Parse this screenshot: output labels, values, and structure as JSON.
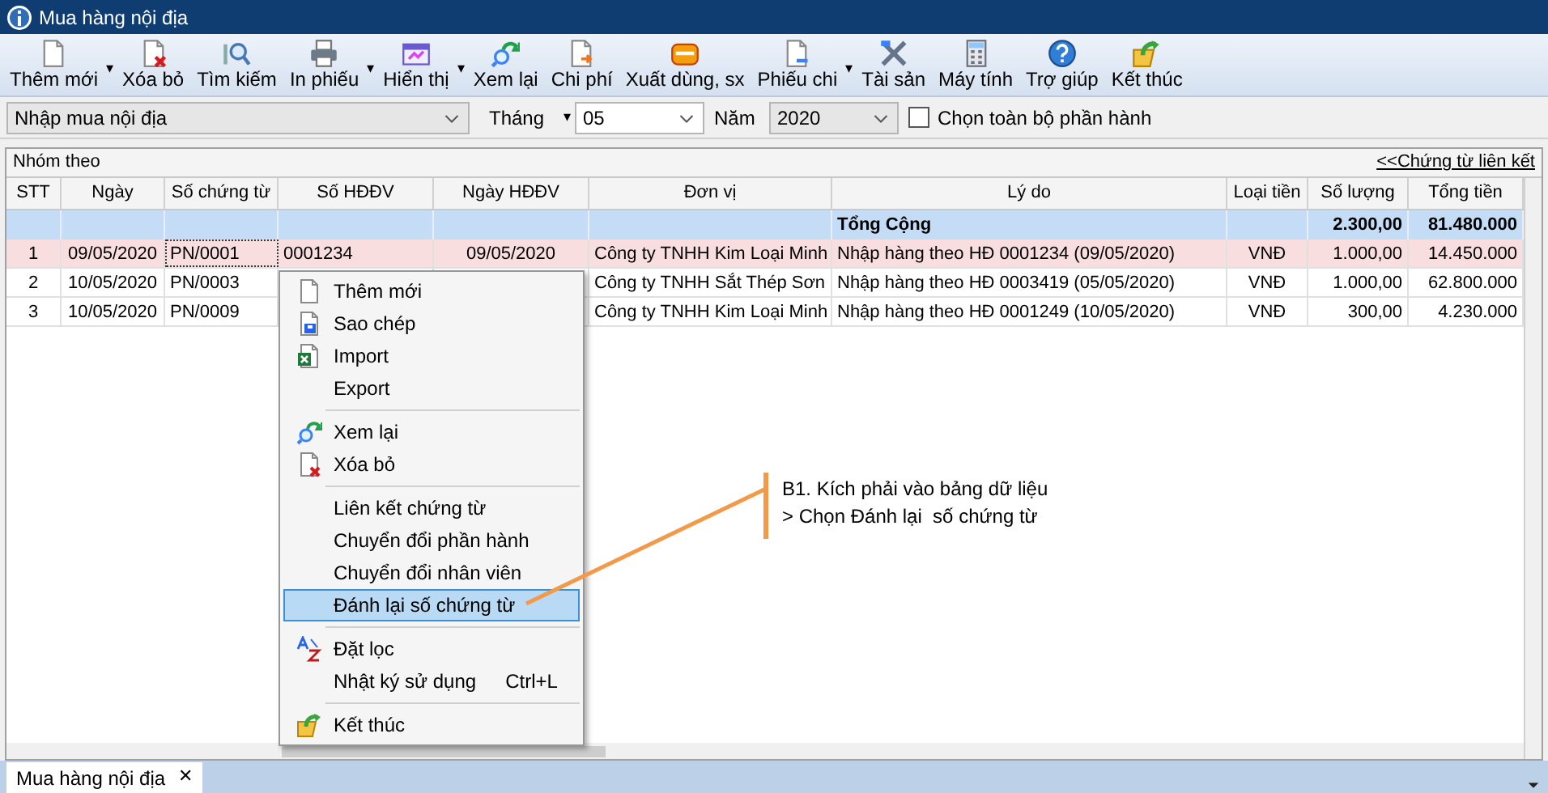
{
  "window": {
    "title": "Mua hàng nội địa"
  },
  "toolbar": [
    {
      "label": "Thêm mới",
      "arrow": "▾"
    },
    {
      "label": "Xóa bỏ"
    },
    {
      "label": "Tìm kiếm"
    },
    {
      "label": "In phiếu",
      "arrow": "▾"
    },
    {
      "label": "Hiển thị",
      "arrow": "▾"
    },
    {
      "label": "Xem lại"
    },
    {
      "label": "Chi phí"
    },
    {
      "label": "Xuất dùng, sx"
    },
    {
      "label": "Phiếu chi",
      "arrow": "▾"
    },
    {
      "label": "Tài sản"
    },
    {
      "label": "Máy tính"
    },
    {
      "label": "Trợ giúp"
    },
    {
      "label": "Kết thúc"
    }
  ],
  "filters": {
    "module": "Nhập mua nội địa",
    "month_label": "Tháng",
    "month_arrow": "▾",
    "month": "05",
    "year_label": "Năm",
    "year": "2020",
    "select_all": {
      "label": "Chọn toàn bộ phần hành",
      "checked": false
    }
  },
  "grid": {
    "group_label": "Nhóm theo",
    "link": "<<Chứng từ liên kết",
    "columns": [
      "STT",
      "Ngày",
      "Số chứng từ",
      "Số HĐĐV",
      "Ngày HĐĐV",
      "Đơn vị",
      "Lý do",
      "Loại tiền",
      "Số lượng",
      "Tổng tiền"
    ],
    "total": {
      "label": "Tổng Cộng",
      "quantity": "2.300,00",
      "amount": "81.480.000"
    },
    "rows": [
      {
        "cells": [
          "1",
          "09/05/2020",
          "PN/0001",
          "0001234",
          "09/05/2020",
          "Công ty TNHH Kim Loại Minh",
          "Nhập hàng theo HĐ 0001234 (09/05/2020)",
          "VNĐ",
          "1.000,00",
          "14.450.000"
        ],
        "selected": true
      },
      {
        "cells": [
          "2",
          "10/05/2020",
          "PN/0003",
          "",
          "",
          "Công ty TNHH Sắt Thép Sơn",
          "Nhập hàng theo HĐ 0003419 (05/05/2020)",
          "VNĐ",
          "1.000,00",
          "62.800.000"
        ],
        "selected": false
      },
      {
        "cells": [
          "3",
          "10/05/2020",
          "PN/0009",
          "",
          "",
          "Công ty TNHH Kim Loại Minh",
          "Nhập hàng theo HĐ 0001249 (10/05/2020)",
          "VNĐ",
          "300,00",
          "4.230.000"
        ],
        "selected": false
      }
    ]
  },
  "context_menu": {
    "groups": [
      [
        {
          "label": "Thêm mới",
          "selected": false
        },
        {
          "label": "Sao chép",
          "selected": false
        },
        {
          "label": "Import",
          "selected": false
        },
        {
          "label": "Export",
          "selected": false
        }
      ],
      [
        {
          "label": "Xem lại",
          "selected": false
        },
        {
          "label": "Xóa bỏ",
          "selected": false
        }
      ],
      [
        {
          "label": "Liên kết chứng từ",
          "selected": false
        },
        {
          "label": "Chuyển đổi phần hành",
          "selected": false
        },
        {
          "label": "Chuyển đổi nhân viên",
          "selected": false
        },
        {
          "label": "Đánh lại số chứng từ",
          "selected": true
        }
      ],
      [
        {
          "label": "Đặt lọc",
          "selected": false
        },
        {
          "label": "Nhật ký sử dụng",
          "shortcut": "Ctrl+L",
          "selected": false
        }
      ],
      [
        {
          "label": "Kết thúc",
          "selected": false
        }
      ]
    ]
  },
  "callout": {
    "lines": [
      "B1. Kích phải vào bảng dữ liệu",
      "> Chọn Đánh lại  số chứng từ"
    ]
  },
  "tabs": [
    {
      "label": "Mua hàng nội địa",
      "close": "✕",
      "selected": true
    }
  ]
}
